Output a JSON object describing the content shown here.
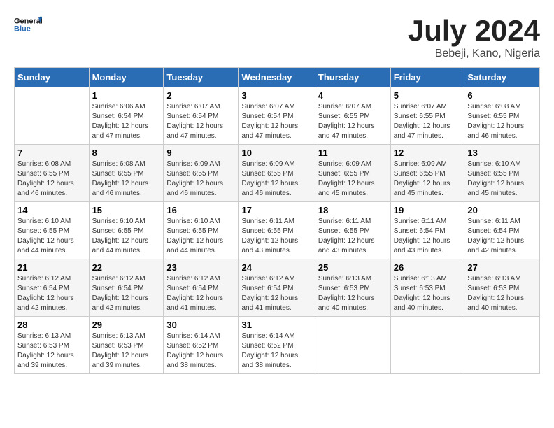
{
  "header": {
    "logo_general": "General",
    "logo_blue": "Blue",
    "month": "July 2024",
    "location": "Bebeji, Kano, Nigeria"
  },
  "columns": [
    "Sunday",
    "Monday",
    "Tuesday",
    "Wednesday",
    "Thursday",
    "Friday",
    "Saturday"
  ],
  "weeks": [
    [
      {
        "day": "",
        "info": ""
      },
      {
        "day": "1",
        "info": "Sunrise: 6:06 AM\nSunset: 6:54 PM\nDaylight: 12 hours\nand 47 minutes."
      },
      {
        "day": "2",
        "info": "Sunrise: 6:07 AM\nSunset: 6:54 PM\nDaylight: 12 hours\nand 47 minutes."
      },
      {
        "day": "3",
        "info": "Sunrise: 6:07 AM\nSunset: 6:54 PM\nDaylight: 12 hours\nand 47 minutes."
      },
      {
        "day": "4",
        "info": "Sunrise: 6:07 AM\nSunset: 6:55 PM\nDaylight: 12 hours\nand 47 minutes."
      },
      {
        "day": "5",
        "info": "Sunrise: 6:07 AM\nSunset: 6:55 PM\nDaylight: 12 hours\nand 47 minutes."
      },
      {
        "day": "6",
        "info": "Sunrise: 6:08 AM\nSunset: 6:55 PM\nDaylight: 12 hours\nand 46 minutes."
      }
    ],
    [
      {
        "day": "7",
        "info": "Sunrise: 6:08 AM\nSunset: 6:55 PM\nDaylight: 12 hours\nand 46 minutes."
      },
      {
        "day": "8",
        "info": "Sunrise: 6:08 AM\nSunset: 6:55 PM\nDaylight: 12 hours\nand 46 minutes."
      },
      {
        "day": "9",
        "info": "Sunrise: 6:09 AM\nSunset: 6:55 PM\nDaylight: 12 hours\nand 46 minutes."
      },
      {
        "day": "10",
        "info": "Sunrise: 6:09 AM\nSunset: 6:55 PM\nDaylight: 12 hours\nand 46 minutes."
      },
      {
        "day": "11",
        "info": "Sunrise: 6:09 AM\nSunset: 6:55 PM\nDaylight: 12 hours\nand 45 minutes."
      },
      {
        "day": "12",
        "info": "Sunrise: 6:09 AM\nSunset: 6:55 PM\nDaylight: 12 hours\nand 45 minutes."
      },
      {
        "day": "13",
        "info": "Sunrise: 6:10 AM\nSunset: 6:55 PM\nDaylight: 12 hours\nand 45 minutes."
      }
    ],
    [
      {
        "day": "14",
        "info": "Sunrise: 6:10 AM\nSunset: 6:55 PM\nDaylight: 12 hours\nand 44 minutes."
      },
      {
        "day": "15",
        "info": "Sunrise: 6:10 AM\nSunset: 6:55 PM\nDaylight: 12 hours\nand 44 minutes."
      },
      {
        "day": "16",
        "info": "Sunrise: 6:10 AM\nSunset: 6:55 PM\nDaylight: 12 hours\nand 44 minutes."
      },
      {
        "day": "17",
        "info": "Sunrise: 6:11 AM\nSunset: 6:55 PM\nDaylight: 12 hours\nand 43 minutes."
      },
      {
        "day": "18",
        "info": "Sunrise: 6:11 AM\nSunset: 6:55 PM\nDaylight: 12 hours\nand 43 minutes."
      },
      {
        "day": "19",
        "info": "Sunrise: 6:11 AM\nSunset: 6:54 PM\nDaylight: 12 hours\nand 43 minutes."
      },
      {
        "day": "20",
        "info": "Sunrise: 6:11 AM\nSunset: 6:54 PM\nDaylight: 12 hours\nand 42 minutes."
      }
    ],
    [
      {
        "day": "21",
        "info": "Sunrise: 6:12 AM\nSunset: 6:54 PM\nDaylight: 12 hours\nand 42 minutes."
      },
      {
        "day": "22",
        "info": "Sunrise: 6:12 AM\nSunset: 6:54 PM\nDaylight: 12 hours\nand 42 minutes."
      },
      {
        "day": "23",
        "info": "Sunrise: 6:12 AM\nSunset: 6:54 PM\nDaylight: 12 hours\nand 41 minutes."
      },
      {
        "day": "24",
        "info": "Sunrise: 6:12 AM\nSunset: 6:54 PM\nDaylight: 12 hours\nand 41 minutes."
      },
      {
        "day": "25",
        "info": "Sunrise: 6:13 AM\nSunset: 6:53 PM\nDaylight: 12 hours\nand 40 minutes."
      },
      {
        "day": "26",
        "info": "Sunrise: 6:13 AM\nSunset: 6:53 PM\nDaylight: 12 hours\nand 40 minutes."
      },
      {
        "day": "27",
        "info": "Sunrise: 6:13 AM\nSunset: 6:53 PM\nDaylight: 12 hours\nand 40 minutes."
      }
    ],
    [
      {
        "day": "28",
        "info": "Sunrise: 6:13 AM\nSunset: 6:53 PM\nDaylight: 12 hours\nand 39 minutes."
      },
      {
        "day": "29",
        "info": "Sunrise: 6:13 AM\nSunset: 6:53 PM\nDaylight: 12 hours\nand 39 minutes."
      },
      {
        "day": "30",
        "info": "Sunrise: 6:14 AM\nSunset: 6:52 PM\nDaylight: 12 hours\nand 38 minutes."
      },
      {
        "day": "31",
        "info": "Sunrise: 6:14 AM\nSunset: 6:52 PM\nDaylight: 12 hours\nand 38 minutes."
      },
      {
        "day": "",
        "info": ""
      },
      {
        "day": "",
        "info": ""
      },
      {
        "day": "",
        "info": ""
      }
    ]
  ]
}
